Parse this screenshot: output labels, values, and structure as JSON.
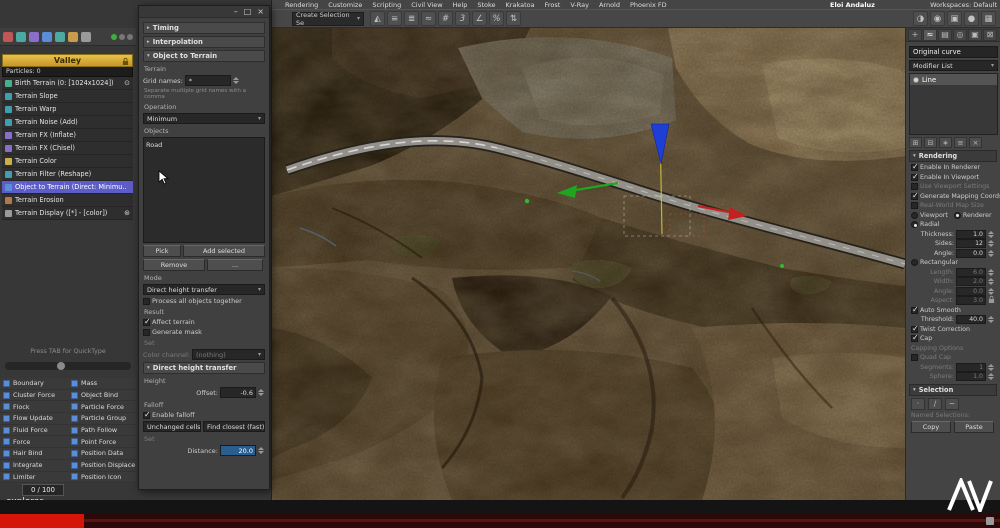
{
  "colors": {
    "selection_accent": "#5d5dc9",
    "value_selected_bg": "#2a5e8f",
    "node_header": "#d4a72c",
    "gizmo_x_red": "#c32020",
    "gizmo_y_green": "#1fa51f",
    "gizmo_z_blue": "#1e3fd6",
    "video_progress": "#d51507"
  },
  "window": {
    "user": "Eloi Andaluz",
    "workspaces": "Workspaces: Default"
  },
  "menu": {
    "items": [
      "Rendering",
      "Customize",
      "Scripting",
      "Civil View",
      "Help",
      "Stoke",
      "Krakatoa",
      "Frost",
      "V-Ray",
      "Arnold",
      "Phoenix FD"
    ]
  },
  "toolbar": {
    "selection_set": "Create Selection Se",
    "left_icons": [
      {
        "name": "undo-icon",
        "g": "↶"
      },
      {
        "name": "redo-icon",
        "g": "↷"
      },
      {
        "name": "select-link-icon",
        "g": "⋈"
      },
      {
        "name": "unlink-icon",
        "g": "⋉"
      },
      {
        "name": "bind-spacewarp-icon",
        "g": "⊕"
      },
      {
        "name": "select-object-icon",
        "g": "►"
      },
      {
        "name": "select-by-name-icon",
        "g": "▤"
      },
      {
        "name": "rect-region-icon",
        "g": "▭"
      },
      {
        "name": "crossing-icon",
        "g": "◫"
      },
      {
        "name": "move-icon",
        "g": "╋"
      },
      {
        "name": "rotate-icon",
        "g": "↻"
      },
      {
        "name": "scale-icon",
        "g": "▱"
      }
    ],
    "mid_icons": [
      {
        "name": "mirror-icon",
        "g": "◭"
      },
      {
        "name": "align-icon",
        "g": "≡"
      },
      {
        "name": "layers-icon",
        "g": "≣"
      },
      {
        "name": "curve-editor-icon",
        "g": "≈"
      },
      {
        "name": "schematic-view-icon",
        "g": "#"
      },
      {
        "name": "snap-toggle-icon",
        "g": "3"
      },
      {
        "name": "angle-snap-icon",
        "g": "∠"
      },
      {
        "name": "percent-snap-icon",
        "g": "%"
      },
      {
        "name": "spinner-snap-icon",
        "g": "⇅"
      }
    ],
    "right_icons": [
      {
        "name": "material-editor-icon",
        "g": "◑"
      },
      {
        "name": "render-setup-icon",
        "g": "◉"
      },
      {
        "name": "rendered-frame-icon",
        "g": "▣"
      },
      {
        "name": "render-production-icon",
        "g": "●"
      },
      {
        "name": "workspace-icon",
        "g": "▦"
      }
    ]
  },
  "editor": {
    "tools": [
      {
        "name": "editor-tool-red",
        "style": "background:#c05656"
      },
      {
        "name": "editor-tool-teal",
        "style": "background:#4aa9a0"
      },
      {
        "name": "editor-tool-violet",
        "style": "background:#8a6fc9"
      },
      {
        "name": "editor-tool-blue",
        "style": "background:#5b8dd9"
      },
      {
        "name": "editor-tool-teal2",
        "style": "background:#4aa9a0"
      },
      {
        "name": "editor-tool-orange",
        "style": "background:#c99b4a"
      },
      {
        "name": "editor-tool-gray",
        "style": "background:#9a9a9a"
      }
    ],
    "node_title": "Valley",
    "particles": "Particles: 0",
    "operators": [
      {
        "label": "Birth Terrain (0: [1024x1024])",
        "icon": "background:#45b08a",
        "badge": "⊙"
      },
      {
        "label": "Terrain Slope",
        "icon": "background:#3f9fae"
      },
      {
        "label": "Terrain Warp",
        "icon": "background:#3f9fae"
      },
      {
        "label": "Terrain Noise (Add)",
        "icon": "background:#3f9fae"
      },
      {
        "label": "Terrain FX (Inflate)",
        "icon": "background:#8a6fc9"
      },
      {
        "label": "Terrain FX (Chisel)",
        "icon": "background:#8a6fc9"
      },
      {
        "label": "Terrain Color",
        "icon": "background:#c9b04a"
      },
      {
        "label": "Terrain Filter (Reshape)",
        "icon": "background:#3f9fae"
      },
      {
        "label": "Object to Terrain (Direct: Minimu...",
        "icon": "background:#5b8dd9",
        "selected": true
      },
      {
        "label": "Terrain Erosion",
        "icon": "background:#b07a45"
      },
      {
        "label": "Terrain Display ([*] - [color])",
        "icon": "background:#9a9a9a",
        "badge": "⊛"
      }
    ],
    "hint": "Press TAB for QuickType",
    "depot_left": [
      "Boundary",
      "Cluster Force",
      "Flock",
      "Flow Update",
      "Fluid Force",
      "Force",
      "Hair Bind",
      "Integrate",
      "Limiter"
    ],
    "depot_right": [
      "Mass",
      "Object Bind",
      "Particle Force",
      "Particle Group",
      "Path Follow",
      "Point Force",
      "Position Data",
      "Position Displace",
      "Position Icon"
    ],
    "explorer": "explorer"
  },
  "props": {
    "timing": "Timing",
    "interpolation": "Interpolation",
    "object_to_terrain": "Object to Terrain",
    "terrain": "Terrain",
    "grid_names_label": "Grid names:",
    "grid_names_value": "*",
    "grid_hint": "Separate multiple grid names with a comma",
    "operation": "Operation",
    "operation_value": "Minimum",
    "objects": "Objects",
    "object_items": [
      "Road"
    ],
    "pick": "Pick",
    "add_selected": "Add selected",
    "remove": "Remove",
    "more": "...",
    "mode": "Mode",
    "mode_value": "Direct height transfer",
    "process_all": "Process all objects together",
    "result": "Result",
    "affect_terrain": "Affect terrain",
    "generate_mask": "Generate mask",
    "set": "Set",
    "color_channel_label": "Color channel:",
    "color_channel_value": "(nothing)",
    "dht": "Direct height transfer",
    "height": "Height",
    "offset_label": "Offset:",
    "offset_value": "-0.6",
    "falloff": "Falloff",
    "enable_falloff": "Enable falloff",
    "unchanged_cells": "Unchanged cells",
    "find_closest": "Find closest (fast)",
    "set2": "Set",
    "distance_label": "Distance:",
    "distance_value": "20.0"
  },
  "cp": {
    "name_value": "Original curve",
    "modifier_list": "Modifier List",
    "stack_item": "Line",
    "rendering": "Rendering",
    "enable_renderer": "Enable In Renderer",
    "enable_viewport": "Enable In Viewport",
    "use_vp_settings": "Use Viewport Settings",
    "gen_mapping": "Generate Mapping Coords.",
    "real_world": "Real-World Map Size",
    "viewport": "Viewport",
    "renderer": "Renderer",
    "radial": "Radial",
    "thickness_label": "Thickness:",
    "thickness": "1.0",
    "sides_label": "Sides:",
    "sides": "12",
    "angle_label": "Angle:",
    "angle": "0.0",
    "rectangular": "Rectangular",
    "length_label": "Length:",
    "length": "6.0",
    "width_label": "Width:",
    "width": "2.0",
    "angle2_label": "Angle:",
    "angle2": "0.0",
    "aspect_label": "Aspect:",
    "aspect": "3.0",
    "auto_smooth": "Auto Smooth",
    "threshold_label": "Threshold:",
    "threshold": "40.0",
    "twist": "Twist Correction",
    "cap": "Cap",
    "capping": "Capping Options",
    "quad_cap": "Quad Cap",
    "segments_label": "Segments:",
    "segments": "1",
    "sphere_label": "Sphere:",
    "sphere": "1.0",
    "selection": "Selection",
    "named": "Named Selections:",
    "copy": "Copy",
    "paste": "Paste"
  },
  "states": {
    "process_all": false,
    "affect_terrain": true,
    "generate_mask": false,
    "enable_falloff": true,
    "enable_renderer": true,
    "enable_viewport": true,
    "use_vp_settings": false,
    "gen_mapping": true,
    "real_world": false,
    "viewport_radio": false,
    "renderer_radio": true,
    "radial": true,
    "rectangular": false,
    "auto_smooth": true,
    "twist": true,
    "cap": true,
    "quad_cap": false
  },
  "timeline": {
    "frame": "0 / 100"
  }
}
